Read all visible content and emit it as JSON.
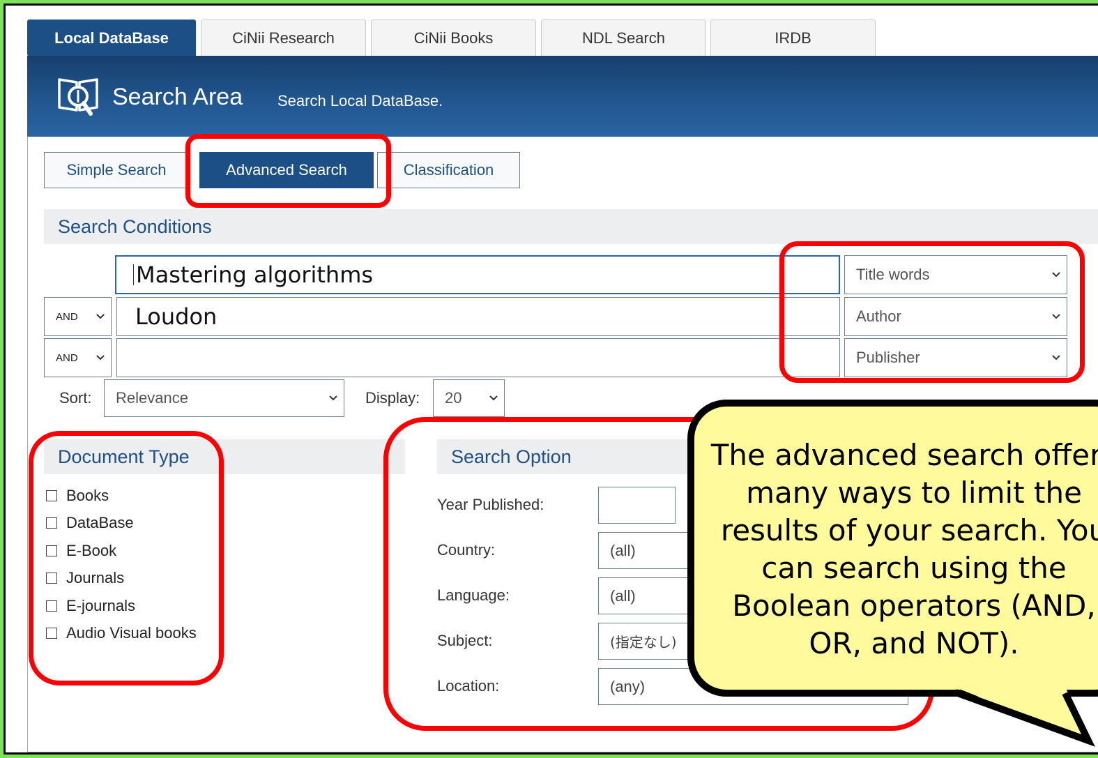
{
  "db_tabs": [
    {
      "label": "Local DataBase",
      "active": true
    },
    {
      "label": "CiNii Research",
      "active": false
    },
    {
      "label": "CiNii Books",
      "active": false
    },
    {
      "label": "NDL Search",
      "active": false
    },
    {
      "label": "IRDB",
      "active": false
    }
  ],
  "header": {
    "title": "Search Area",
    "subtitle": "Search Local DataBase."
  },
  "mode_tabs": [
    {
      "label": "Simple Search",
      "active": false
    },
    {
      "label": "Advanced Search",
      "active": true
    },
    {
      "label": "Classification",
      "active": false
    }
  ],
  "search_conditions": {
    "heading": "Search Conditions",
    "rows": [
      {
        "operator": "",
        "value": "Mastering algorithms",
        "field": "Title words"
      },
      {
        "operator": "AND",
        "value": "Loudon",
        "field": "Author"
      },
      {
        "operator": "AND",
        "value": "",
        "field": "Publisher"
      }
    ]
  },
  "sort": {
    "label": "Sort:",
    "value": "Relevance"
  },
  "display": {
    "label": "Display:",
    "value": "20"
  },
  "document_type": {
    "heading": "Document Type",
    "items": [
      "Books",
      "DataBase",
      "E-Book",
      "Journals",
      "E-journals",
      "Audio Visual books"
    ]
  },
  "search_option": {
    "heading": "Search Option",
    "fields": [
      {
        "label": "Year Published:",
        "value": ""
      },
      {
        "label": "Country:",
        "value": "(all)"
      },
      {
        "label": "Language:",
        "value": "(all)"
      },
      {
        "label": "Subject:",
        "value": "(指定なし)"
      },
      {
        "label": "Location:",
        "value": "(any)"
      }
    ]
  },
  "callout": {
    "lines": [
      "The advanced search offers",
      "many ways to limit the",
      "results of your search. You",
      "can search using the",
      "Boolean operators (AND,",
      "OR, and NOT)."
    ]
  },
  "colors": {
    "background": "#7ee15a",
    "navy": "#1c4f86",
    "highlight": "#ff0000",
    "callout_fill": "#fffb9c"
  }
}
